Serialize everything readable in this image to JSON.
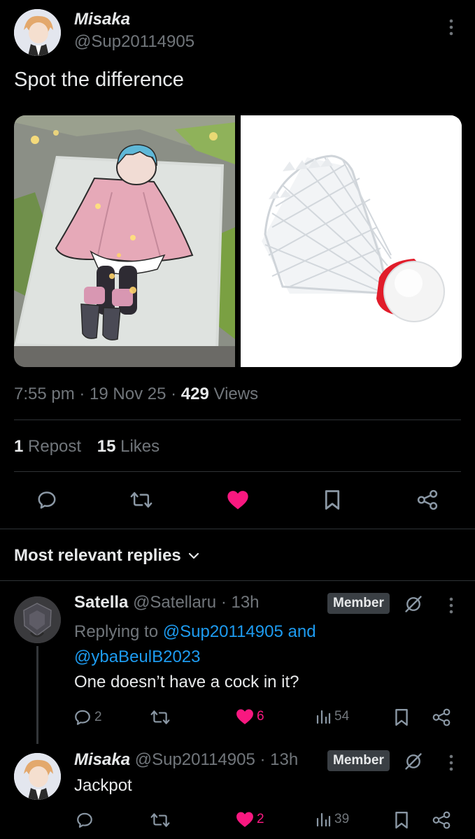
{
  "post": {
    "display_name": "Misaka",
    "handle": "@Sup20114905",
    "text": "Spot the difference",
    "time": "7:55 pm",
    "date": "19 Nov 25",
    "views_count": "429",
    "views_label": "Views",
    "reposts_count": "1",
    "reposts_label": "Repost",
    "likes_count": "15",
    "likes_label": "Likes"
  },
  "replies_header": {
    "label": "Most relevant replies"
  },
  "replies": [
    {
      "display_name": "Satella",
      "handle": "@Satellaru",
      "time": "13h",
      "badge": "Member",
      "replying_prefix": "Replying to",
      "replying_users": "@Sup20114905",
      "replying_and": "and",
      "replying_users_2": "@ybaBeulB2023",
      "text": "One doesn’t have a cock in it?",
      "reply_count": "2",
      "like_count": "6",
      "view_count": "54"
    },
    {
      "display_name": "Misaka",
      "handle": "@Sup20114905",
      "time": "13h",
      "badge": "Member",
      "text": "Jackpot",
      "like_count": "2",
      "view_count": "39"
    }
  ],
  "colors": {
    "accent": "#1d9bf0",
    "like": "#f91880",
    "muted": "#71767b",
    "background": "#000000"
  }
}
